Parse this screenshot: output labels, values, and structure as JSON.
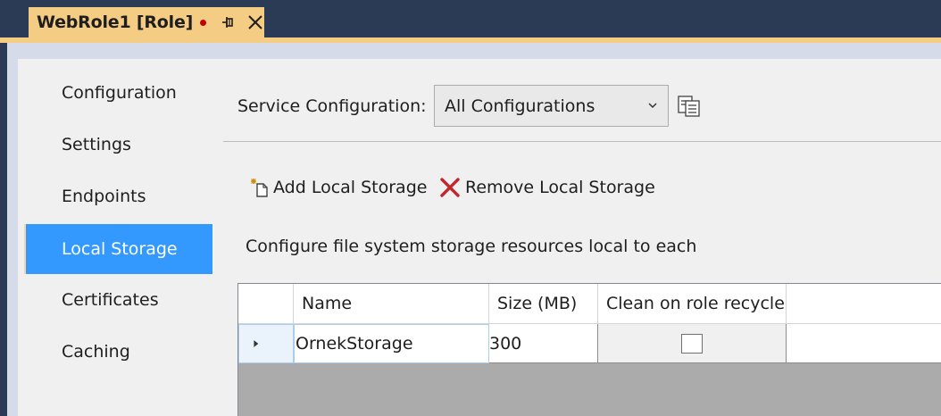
{
  "document_tab": {
    "title": "WebRole1 [Role]",
    "dirty_indicator_color": "#c20000",
    "pin_icon": "pin-icon",
    "close_icon": "close-icon"
  },
  "nav": {
    "items": [
      {
        "label": "Configuration",
        "selected": false
      },
      {
        "label": "Settings",
        "selected": false
      },
      {
        "label": "Endpoints",
        "selected": false
      },
      {
        "label": "Local Storage",
        "selected": true
      },
      {
        "label": "Certificates",
        "selected": false
      },
      {
        "label": "Caching",
        "selected": false
      }
    ]
  },
  "service_config": {
    "label": "Service Configuration:",
    "selected": "All Configurations",
    "copy_icon": "copy-settings-icon"
  },
  "toolbar": {
    "add_label": "Add Local Storage",
    "remove_label": "Remove Local Storage"
  },
  "description": "Configure file system storage resources local to each",
  "grid": {
    "columns": [
      "Name",
      "Size (MB)",
      "Clean on role recycle"
    ],
    "rows": [
      {
        "name": "OrnekStorage",
        "size": "300",
        "clean_on_recycle": false
      }
    ]
  },
  "colors": {
    "tab_accent": "#f5cc84",
    "selection": "#3399ff",
    "chrome": "#2b3a55"
  }
}
